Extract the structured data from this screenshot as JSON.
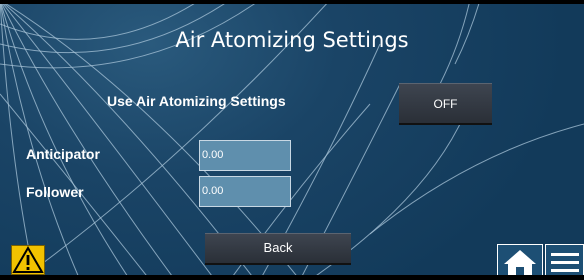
{
  "screen": {
    "title": "Air Atomizing Settings"
  },
  "settings": {
    "use_air_atomizing_label": "Use Air Atomizing Settings",
    "toggle_value": "OFF",
    "anticipator_label": "Anticipator",
    "anticipator_value": "0.00",
    "follower_label": "Follower",
    "follower_value": "0.00"
  },
  "footer": {
    "back_label": "Back",
    "warning_icon": "warning-icon",
    "home_icon": "home-icon",
    "menu_icon": "menu-icon"
  },
  "colors": {
    "background": "#1a4466",
    "field": "#5f8fad",
    "button": "#2f353e",
    "warning": "#f2c200"
  }
}
